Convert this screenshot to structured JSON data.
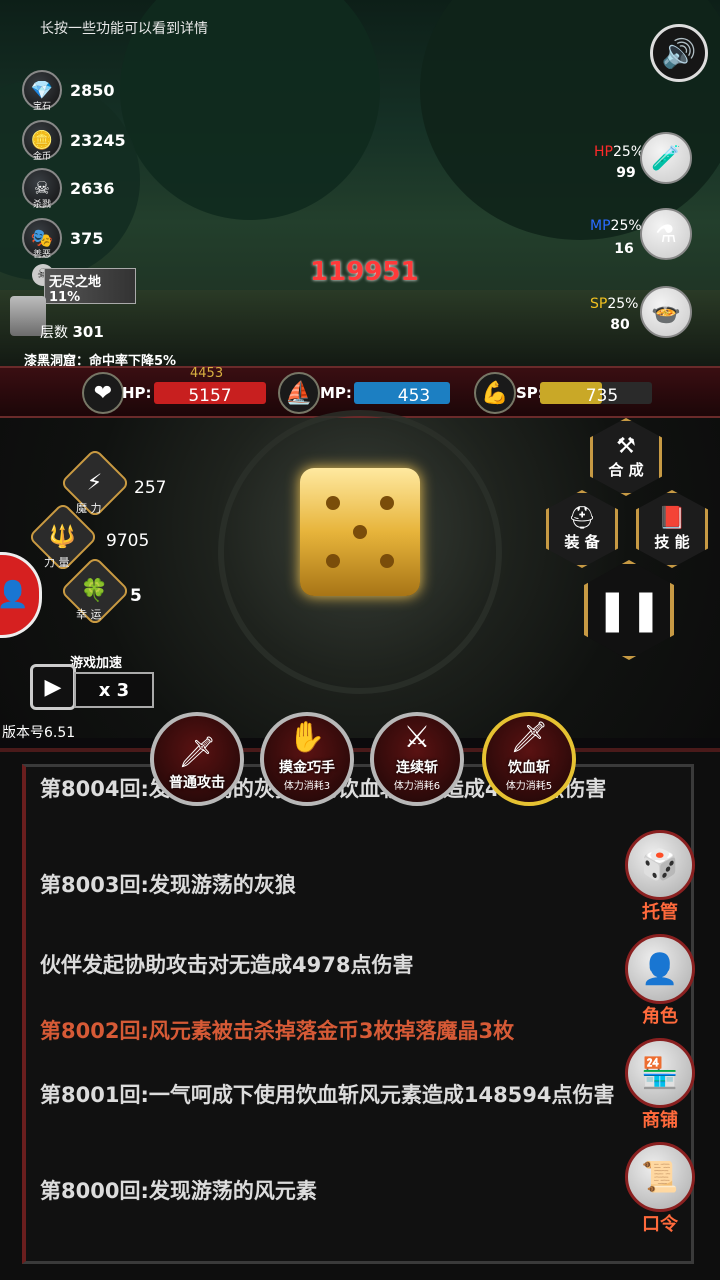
{
  "hint": "长按一些功能可以看到详情",
  "resources": [
    {
      "icon": "gem-icon",
      "label": "宝石",
      "value": "2850"
    },
    {
      "icon": "coin-icon",
      "label": "金币",
      "value": "23245"
    },
    {
      "icon": "skull-icon",
      "label": "杀戮",
      "value": "2636"
    },
    {
      "icon": "mask-icon",
      "label": "善恶",
      "value": "375"
    }
  ],
  "dungeon": {
    "endless": "无尽之地11%",
    "floor_label": "层数",
    "floor_value": "301",
    "cave_effect": "漆黑洞窟：命中率下降5%"
  },
  "damage_popup": "119951",
  "potions": [
    {
      "key": "HP",
      "pct": "25%",
      "count": "99",
      "color": "#ff2a2a"
    },
    {
      "key": "MP",
      "pct": "25%",
      "count": "16",
      "color": "#2a6bff"
    },
    {
      "key": "SP",
      "pct": "25%",
      "count": "80",
      "color": "#f0c020"
    }
  ],
  "bars": {
    "hp": {
      "label": "HP:",
      "value": "5157",
      "sub": "4453",
      "fill": 1.0
    },
    "mp": {
      "label": "MP:",
      "value": "453",
      "fill": 1.0
    },
    "sp": {
      "label": "SP:",
      "value": "735",
      "fill": 0.55
    }
  },
  "stats": [
    {
      "label": "魔 力",
      "value": "257"
    },
    {
      "label": "力 量",
      "value": "9705"
    },
    {
      "label": "幸 运",
      "value": "5"
    }
  ],
  "speed": {
    "label": "游戏加速",
    "multiplier": "x 3"
  },
  "version": "版本号6.51",
  "actions": {
    "synth": "合 成",
    "equip": "装 备",
    "skill": "技 能"
  },
  "skills": [
    {
      "name": "普通攻击",
      "cost": ""
    },
    {
      "name": "摸金巧手",
      "cost": "体力消耗3"
    },
    {
      "name": "连续斩",
      "cost": "体力消耗6"
    },
    {
      "name": "饮血斩",
      "cost": "体力消耗5"
    }
  ],
  "log": [
    {
      "text": "第8004回:发现游荡的灰狼使用饮血斩灰狼造成4551点伤害",
      "red": false
    },
    {
      "text": "第8003回:发现游荡的灰狼",
      "red": false
    },
    {
      "text": "伙伴发起协助攻击对无造成4978点伤害",
      "red": false
    },
    {
      "text": "第8002回:风元素被击杀掉落金币3枚掉落魔晶3枚",
      "red": true
    },
    {
      "text": "第8001回:一气呵成下使用饮血斩风元素造成148594点伤害",
      "red": false
    },
    {
      "text": "第8000回:发现游荡的风元素",
      "red": false
    }
  ],
  "menu": [
    {
      "label": "托管",
      "icon": "dice-icon"
    },
    {
      "label": "角色",
      "icon": "hood-icon"
    },
    {
      "label": "商铺",
      "icon": "shop-icon"
    },
    {
      "label": "口令",
      "icon": "scroll-icon"
    }
  ]
}
